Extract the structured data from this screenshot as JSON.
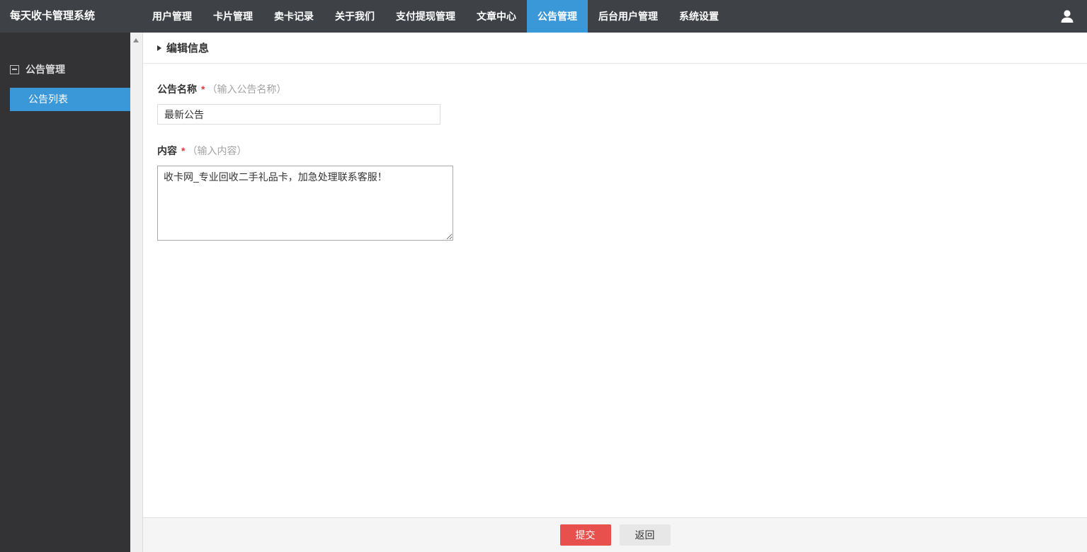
{
  "app": {
    "title": "每天收卡管理系统"
  },
  "navbar": {
    "items": [
      {
        "label": "用户管理",
        "active": false
      },
      {
        "label": "卡片管理",
        "active": false
      },
      {
        "label": "卖卡记录",
        "active": false
      },
      {
        "label": "关于我们",
        "active": false
      },
      {
        "label": "支付提现管理",
        "active": false
      },
      {
        "label": "文章中心",
        "active": false
      },
      {
        "label": "公告管理",
        "active": true
      },
      {
        "label": "后台用户管理",
        "active": false
      },
      {
        "label": "系统设置",
        "active": false
      }
    ]
  },
  "sidebar": {
    "group_label": "公告管理",
    "items": [
      {
        "label": "公告列表",
        "active": true
      }
    ]
  },
  "main": {
    "section_title": "编辑信息",
    "fields": {
      "name": {
        "label": "公告名称",
        "required_mark": "*",
        "hint": "（输入公告名称）",
        "value": "最新公告"
      },
      "content": {
        "label": "内容",
        "required_mark": "*",
        "hint": "（输入内容）",
        "value": "收卡网_专业回收二手礼品卡，加急处理联系客服！"
      }
    },
    "actions": {
      "submit_label": "提交",
      "back_label": "返回"
    }
  },
  "colors": {
    "navbar_bg": "#3e4146",
    "sidebar_bg": "#333336",
    "accent_blue": "#3a98d8",
    "submit_red": "#e8504e",
    "required_red": "#e4393c",
    "footer_bg": "#f5f5f5"
  }
}
